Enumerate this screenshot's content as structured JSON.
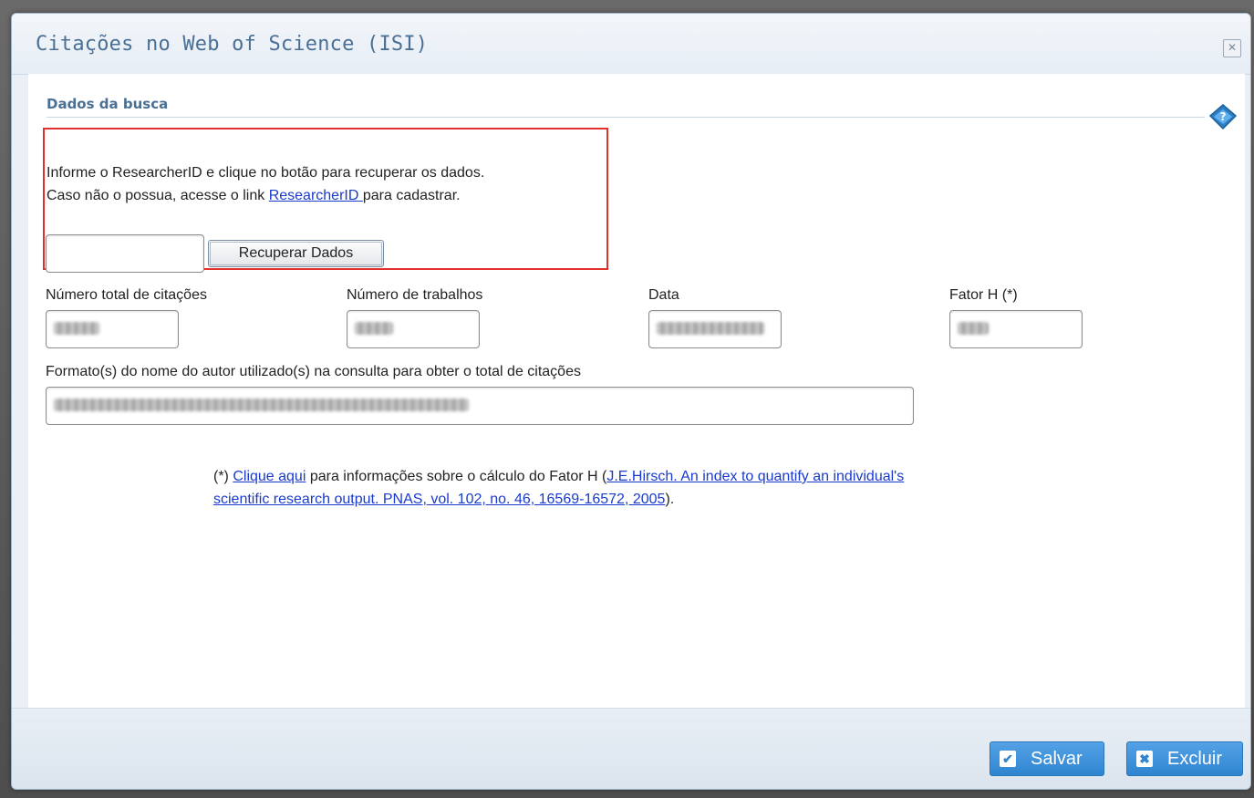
{
  "dialog": {
    "title": "Citações no Web of Science (ISI)",
    "close_glyph": "✕"
  },
  "section": {
    "label": "Dados da busca",
    "help_icon": "help-book-icon"
  },
  "search": {
    "instruction_line1": "Informe o ResearcherID e clique no botão para recuperar os dados.",
    "instruction_line2_prefix": "Caso não o possua, acesse o link ",
    "instruction_line2_link": "ResearcherID ",
    "instruction_line2_suffix": "para cadastrar.",
    "researcher_id_value": "",
    "retrieve_button": "Recuperar Dados"
  },
  "fields": {
    "total_citations_label": "Número total de citações",
    "num_works_label": "Número de trabalhos",
    "date_label": "Data",
    "h_factor_label": "Fator H (*)",
    "author_formats_label": "Formato(s) do nome do autor utilizado(s) na consulta para obter o total de citações"
  },
  "note": {
    "prefix": "(*) ",
    "link1": "Clique aqui",
    "middle": " para informações sobre o cálculo do Fator H (",
    "link2_line1": "J.E.Hirsch. An index to quantify an individual's",
    "link2_line2": "scientific research output. PNAS, vol. 102, no. 46, 16569-16572, 2005",
    "suffix": ")."
  },
  "footer": {
    "save_label": "Salvar",
    "save_icon": "check-icon",
    "delete_label": "Excluir",
    "delete_icon": "x-icon"
  },
  "colors": {
    "title_blue": "#4a6f95",
    "highlight_red": "#e2312d",
    "link_blue": "#1a3acc",
    "button_blue": "#2f84d0"
  }
}
